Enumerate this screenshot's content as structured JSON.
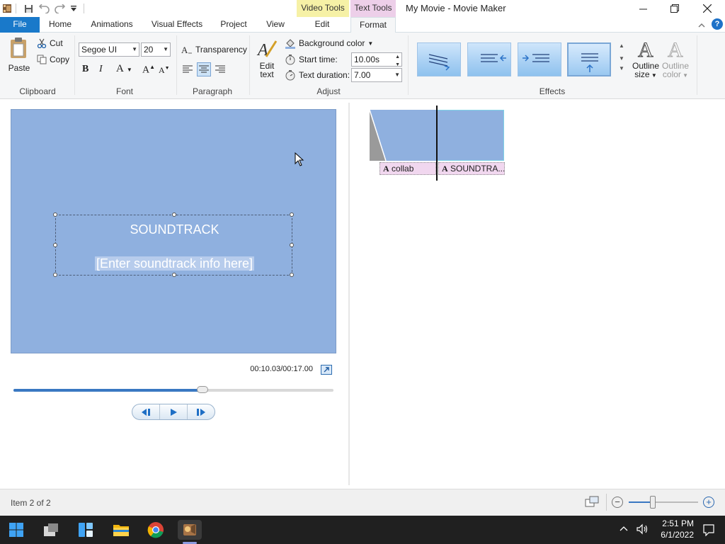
{
  "window": {
    "title": "My Movie - Movie Maker"
  },
  "context_tabs": {
    "video_tools": "Video Tools",
    "text_tools": "Text Tools"
  },
  "tabs": [
    {
      "label": "File"
    },
    {
      "label": "Home"
    },
    {
      "label": "Animations"
    },
    {
      "label": "Visual Effects"
    },
    {
      "label": "Project"
    },
    {
      "label": "View"
    },
    {
      "label": "Edit"
    },
    {
      "label": "Format"
    }
  ],
  "ribbon": {
    "clipboard": {
      "paste": "Paste",
      "cut": "Cut",
      "copy": "Copy",
      "group": "Clipboard"
    },
    "font": {
      "family": "Segoe UI",
      "size": "20",
      "group": "Font",
      "bold": "B",
      "italic": "I",
      "color": "A",
      "grow": "A",
      "shrink": "A"
    },
    "paragraph": {
      "transparency": "Transparency",
      "group": "Paragraph"
    },
    "adjust": {
      "edit_text_line1": "Edit",
      "edit_text_line2": "text",
      "background_color": "Background color",
      "start_time_label": "Start time:",
      "start_time_value": "10.00s",
      "text_duration_label": "Text duration:",
      "text_duration_value": "7.00",
      "group": "Adjust"
    },
    "effects": {
      "group": "Effects",
      "outline_size_line1": "Outline",
      "outline_size_line2": "size",
      "outline_color_line1": "Outline",
      "outline_color_line2": "color"
    }
  },
  "preview": {
    "title_text": "SOUNDTRACK",
    "info_text": "[Enter soundtrack info here]",
    "time_display": "00:10.03/00:17.00",
    "progress_fraction": 0.59
  },
  "timeline": {
    "clips": [
      {
        "caption": "collab"
      },
      {
        "caption": "SOUNDTRA..."
      }
    ]
  },
  "status": {
    "item_text": "Item 2 of 2",
    "zoom_fraction": 0.35
  },
  "taskbar": {
    "time": "2:51 PM",
    "date": "6/1/2022"
  },
  "colors": {
    "file_tab": "#1979ca",
    "preview_bg": "#8fb0df",
    "video_tools_tab": "#f6f1a6",
    "text_tools_tab": "#edcfe9"
  }
}
